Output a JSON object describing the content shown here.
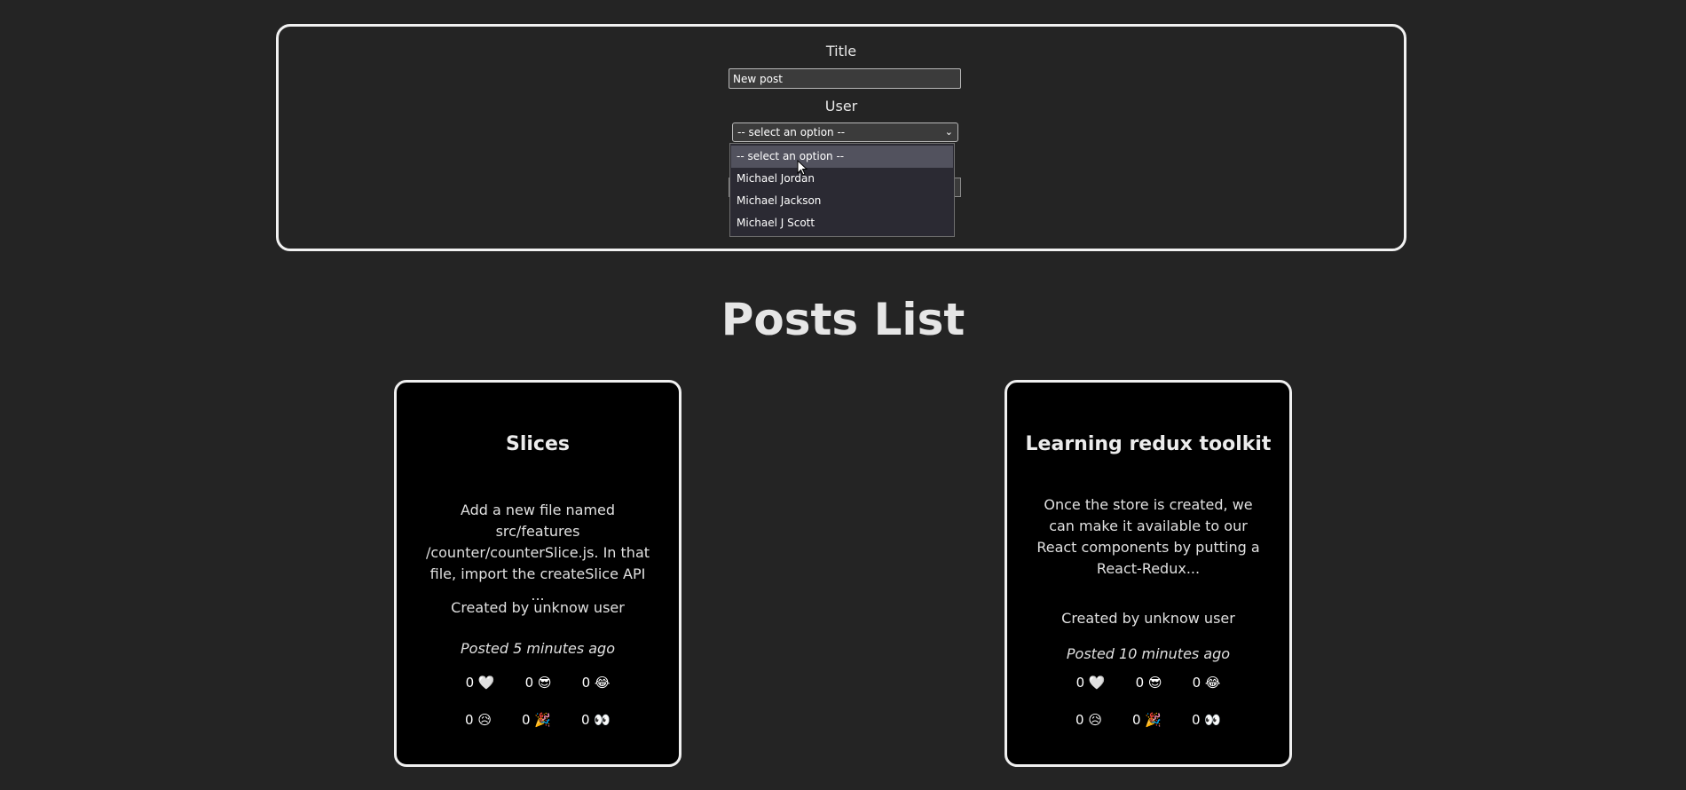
{
  "form": {
    "title_label": "Title",
    "title_value": "New post",
    "user_label": "User",
    "user_selected": "-- select an option --",
    "user_options": [
      "-- select an option --",
      "Michael Jordan",
      "Michael Jackson",
      "Michael J Scott"
    ]
  },
  "heading": "Posts List",
  "posts": [
    {
      "title": "Slices",
      "body": "Add a new file named src/features /counter/counterSlice.js. In that file, import the createSlice API ...",
      "author": "Created by unknow user",
      "time": "Posted 5 minutes ago",
      "reactions": [
        {
          "count": "0",
          "emoji": "🤍"
        },
        {
          "count": "0",
          "emoji": "😎"
        },
        {
          "count": "0",
          "emoji": "😂"
        },
        {
          "count": "0",
          "emoji": "😥"
        },
        {
          "count": "0",
          "emoji": "🎉"
        },
        {
          "count": "0",
          "emoji": "👀"
        }
      ]
    },
    {
      "title": "Learning redux toolkit",
      "body": "Once the store is created, we can make it available to our React components by putting a React-Redux...",
      "author": "Created by unknow user",
      "time": "Posted 10 minutes ago",
      "reactions": [
        {
          "count": "0",
          "emoji": "🤍"
        },
        {
          "count": "0",
          "emoji": "😎"
        },
        {
          "count": "0",
          "emoji": "😂"
        },
        {
          "count": "0",
          "emoji": "😥"
        },
        {
          "count": "0",
          "emoji": "🎉"
        },
        {
          "count": "0",
          "emoji": "👀"
        }
      ]
    }
  ]
}
